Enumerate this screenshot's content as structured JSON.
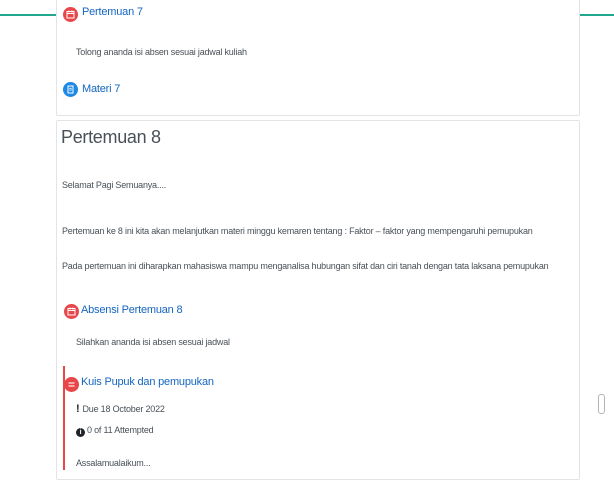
{
  "colors": {
    "accent_top_border": "#20a78e",
    "link": "#1565c0",
    "attendance_icon": "#e8474a",
    "resource_icon": "#1e88e5",
    "quiz_highlight": "#e8474a"
  },
  "top_card": {
    "activity_1": {
      "icon": "attendance-icon",
      "title": "Pertemuan 7",
      "description": "Tolong ananda isi absen sesuai jadwal kuliah"
    },
    "activity_2": {
      "icon": "resource-icon",
      "title": "Materi 7"
    }
  },
  "section": {
    "title": "Pertemuan 8",
    "paragraphs": [
      "Selamat Pagi Semuanya....",
      "Pertemuan ke 8 ini kita akan melanjutkan materi minggu kemaren  tentang : Faktor – faktor yang mempengaruhi pemupukan",
      "Pada pertemuan ini diharapkan mahasiswa mampu menganalisa hubungan sifat dan ciri tanah dengan tata laksana pemupukan"
    ],
    "attendance": {
      "icon": "attendance-icon",
      "title": "Absensi Pertemuan 8",
      "description": "Silahkan ananda isi absen sesuai jadwal"
    },
    "quiz": {
      "icon": "quiz-icon",
      "title": "Kuis Pupuk dan pemupukan",
      "due": "Due 18 October 2022",
      "attempts": "0 of 11 Attempted",
      "description": "Assalamualaikum..."
    }
  }
}
